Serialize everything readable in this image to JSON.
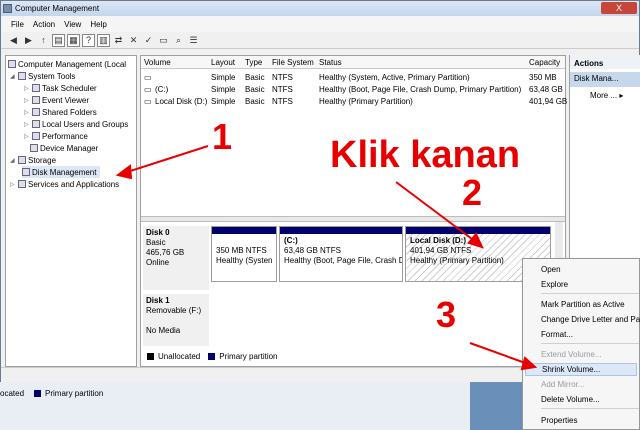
{
  "window": {
    "title": "Computer Management",
    "close_label": "X"
  },
  "menu": [
    "File",
    "Action",
    "View",
    "Help"
  ],
  "tree": {
    "root": "Computer Management (Local",
    "system_tools": "System Tools",
    "items": [
      "Task Scheduler",
      "Event Viewer",
      "Shared Folders",
      "Local Users and Groups",
      "Performance",
      "Device Manager"
    ],
    "storage": "Storage",
    "disk_management": "Disk Management",
    "services": "Services and Applications"
  },
  "volumes": {
    "headers": [
      "Volume",
      "Layout",
      "Type",
      "File System",
      "Status",
      "Capacity"
    ],
    "rows": [
      [
        "",
        "Simple",
        "Basic",
        "NTFS",
        "Healthy (System, Active, Primary Partition)",
        "350 MB"
      ],
      [
        "(C:)",
        "Simple",
        "Basic",
        "NTFS",
        "Healthy (Boot, Page File, Crash Dump, Primary Partition)",
        "63,48 GB"
      ],
      [
        "Local Disk (D:)",
        "Simple",
        "Basic",
        "NTFS",
        "Healthy (Primary Partition)",
        "401,94 GB"
      ]
    ]
  },
  "disks": {
    "disk0": {
      "name": "Disk 0",
      "type": "Basic",
      "size": "465,76 GB",
      "status": "Online"
    },
    "p1": {
      "title": "",
      "size": "350 MB NTFS",
      "status": "Healthy (Systen"
    },
    "p2": {
      "title": "(C:)",
      "size": "63,48 GB NTFS",
      "status": "Healthy (Boot, Page File, Crash D"
    },
    "p3": {
      "title": "Local Disk  (D:)",
      "size": "401,94 GB NTFS",
      "status": "Healthy (Primary Partition)"
    },
    "disk1": {
      "name": "Disk 1",
      "type": "Removable (F:)",
      "media": "No Media"
    }
  },
  "legend": {
    "unallocated": "Unallocated",
    "primary": "Primary partition"
  },
  "actions": {
    "header": "Actions",
    "selected": "Disk Mana...",
    "more": "More ..."
  },
  "context_menu": {
    "open": "Open",
    "explore": "Explore",
    "mark_active": "Mark Partition as Active",
    "change_letter": "Change Drive Letter and Pa",
    "format": "Format...",
    "extend": "Extend Volume...",
    "shrink": "Shrink Volume...",
    "add_mirror": "Add Mirror...",
    "delete": "Delete Volume...",
    "properties": "Properties"
  },
  "annotations": {
    "one": "1",
    "two": "2",
    "three": "3",
    "klik": "Klik kanan"
  },
  "bg_window": {
    "unallocated": "ocated",
    "primary": "Primary partition"
  },
  "colors": {
    "primary_partition": "#00006e",
    "annotation": "#e80000",
    "unallocated": "#000000"
  }
}
